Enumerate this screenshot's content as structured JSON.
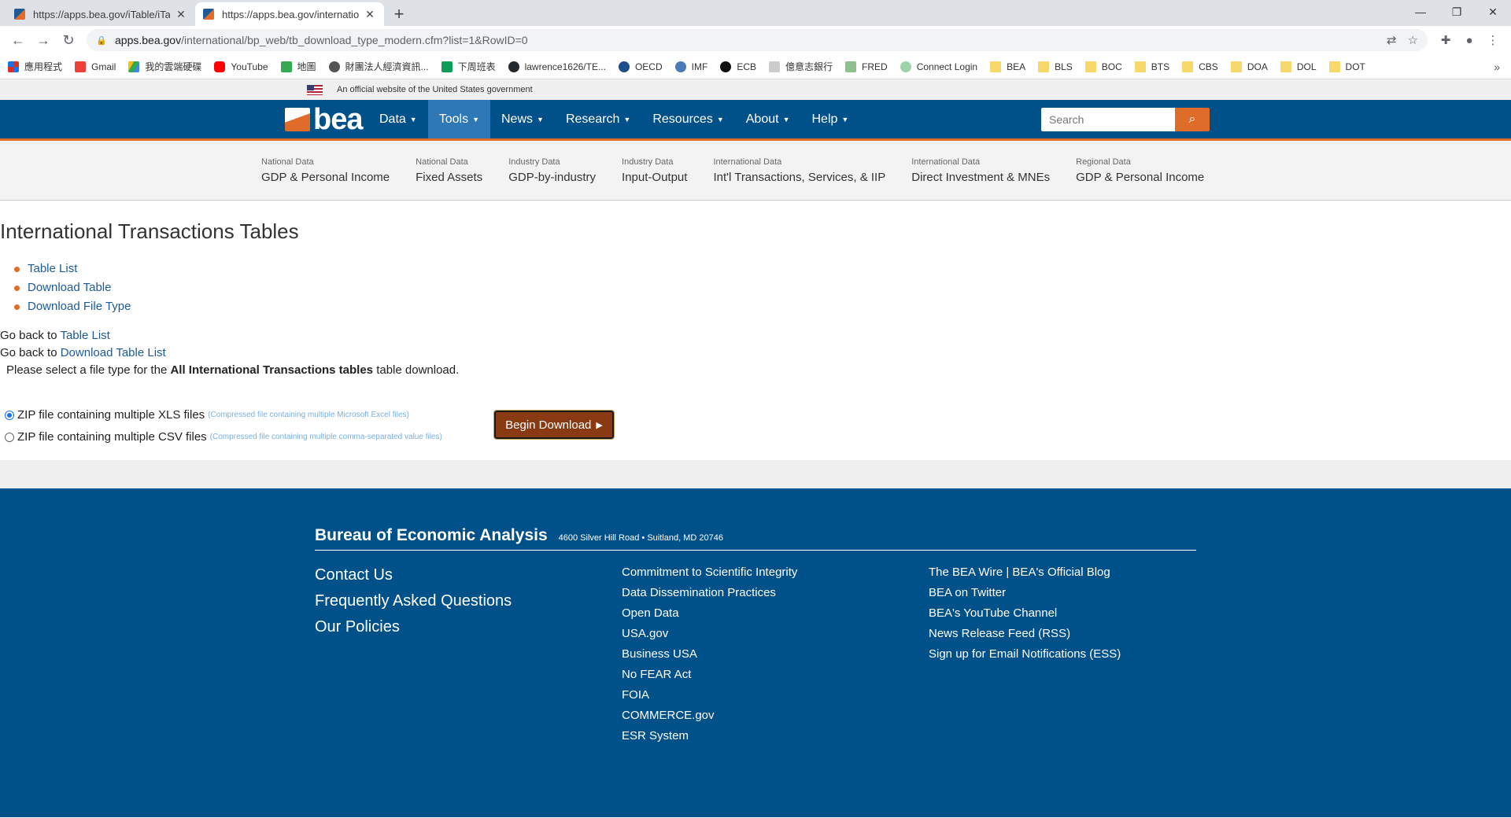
{
  "browser": {
    "tabs": [
      {
        "title": "https://apps.bea.gov/iTable/iTa"
      },
      {
        "title": "https://apps.bea.gov/internatio"
      }
    ],
    "new_tab": "+",
    "url_host": "apps.bea.gov",
    "url_path": "/international/bp_web/tb_download_type_modern.cfm?list=1&RowID=0",
    "bookmarks": [
      "應用程式",
      "Gmail",
      "我的雲端硬碟",
      "YouTube",
      "地圖",
      "財團法人經濟資訊...",
      "下周班表",
      "lawrence1626/TE...",
      "OECD",
      "IMF",
      "ECB",
      "億意志銀行",
      "FRED",
      "Connect Login",
      "BEA",
      "BLS",
      "BOC",
      "BTS",
      "CBS",
      "DOA",
      "DOL",
      "DOT"
    ],
    "bookmarks_more": "»"
  },
  "gov_banner": "An official website of the United States government",
  "nav": {
    "logo": "bea",
    "menu": [
      "Data",
      "Tools",
      "News",
      "Research",
      "Resources",
      "About",
      "Help"
    ],
    "active": "Tools",
    "search_placeholder": "Search"
  },
  "subnav": [
    {
      "cat": "National Data",
      "name": "GDP & Personal Income"
    },
    {
      "cat": "National Data",
      "name": "Fixed Assets"
    },
    {
      "cat": "Industry Data",
      "name": "GDP-by-industry"
    },
    {
      "cat": "Industry Data",
      "name": "Input-Output"
    },
    {
      "cat": "International Data",
      "name": "Int'l Transactions, Services, & IIP"
    },
    {
      "cat": "International Data",
      "name": "Direct Investment & MNEs"
    },
    {
      "cat": "Regional Data",
      "name": "GDP & Personal Income"
    }
  ],
  "content": {
    "title": "International Transactions Tables",
    "steps": [
      "Table List",
      "Download Table",
      "Download File Type"
    ],
    "go_back_prefix": "Go back to",
    "go_back_links": [
      "Table List",
      "Download Table List"
    ],
    "instruction_pre": "Please select a file type for the",
    "instruction_bold": "All International Transactions tables",
    "instruction_post": "table download.",
    "options": [
      {
        "label": "ZIP file containing multiple XLS files",
        "hint": "(Compressed file containing multiple Microsoft Excel files)",
        "checked": true
      },
      {
        "label": "ZIP file containing multiple CSV files",
        "hint": "(Compressed file containing multiple comma-separated value files)",
        "checked": false
      }
    ],
    "download_button": "Begin Download"
  },
  "footer": {
    "org": "Bureau of Economic Analysis",
    "address": "4600 Silver Hill Road • Suitland, MD 20746",
    "col1": [
      "Contact Us",
      "Frequently Asked Questions",
      "Our Policies"
    ],
    "col2": [
      "Commitment to Scientific Integrity",
      "Data Dissemination Practices",
      "Open Data",
      "USA.gov",
      "Business USA",
      "No FEAR Act",
      "FOIA",
      "COMMERCE.gov",
      "ESR System"
    ],
    "col3": [
      "The BEA Wire | BEA's Official Blog",
      "BEA on Twitter",
      "BEA's YouTube Channel",
      "News Release Feed (RSS)",
      "Sign up for Email Notifications (ESS)"
    ]
  },
  "colors": {
    "brand_blue": "#00508a",
    "accent_orange": "#e06c2a",
    "link_blue": "#1e5a96",
    "button_brown": "#8a3a12"
  }
}
